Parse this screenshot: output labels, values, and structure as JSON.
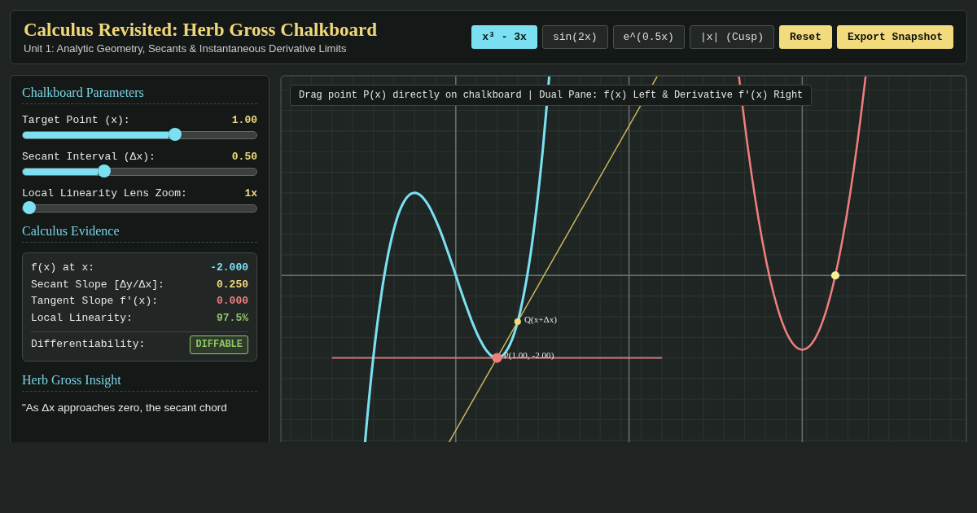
{
  "header": {
    "title": "Calculus Revisited: Herb Gross Chalkboard",
    "subtitle": "Unit 1: Analytic Geometry, Secants & Instantaneous Derivative Limits"
  },
  "function_buttons": [
    {
      "label": "x³ - 3x",
      "selected": true
    },
    {
      "label": "sin(2x)",
      "selected": false
    },
    {
      "label": "e^(0.5x)",
      "selected": false
    },
    {
      "label": "|x| (Cusp)",
      "selected": false
    }
  ],
  "action_buttons": [
    "Reset",
    "Export Snapshot"
  ],
  "parameters": {
    "title": "Chalkboard Parameters",
    "sliders": [
      {
        "label": "Target Point (x):",
        "reading": "1.00",
        "level": 0.66
      },
      {
        "label": "Secant Interval (Δx):",
        "reading": "0.50",
        "level": 0.34
      },
      {
        "label": "Local Linearity Lens Zoom:",
        "reading": "1x",
        "level": 0
      }
    ]
  },
  "evidence": {
    "title": "Calculus Evidence",
    "rows": [
      {
        "label": "f(x) at x:",
        "value": "-2.000",
        "color": "#7be0f2"
      },
      {
        "label": "Secant Slope [Δy/Δx]:",
        "value": "0.250",
        "color": "#f5d97a"
      },
      {
        "label": "Tangent Slope f'(x):",
        "value": "0.000",
        "color": "#ef7f7f"
      },
      {
        "label": "Local Linearity:",
        "value": "97.5%",
        "color": "#8fc76a"
      }
    ],
    "differentiability": {
      "label": "Differentiability:",
      "badge": "DIFFABLE"
    }
  },
  "insight": {
    "title": "Herb Gross Insight",
    "text": "\"As Δx approaches zero, the secant chord"
  },
  "chalkboard": {
    "hint": "Drag point P(x) directly on chalkboard | Dual Pane: f(x) Left & Derivative f'(x) Right",
    "q_label": "Q(x+Δx)",
    "p_label": "P(1.00, -2.00)"
  }
}
